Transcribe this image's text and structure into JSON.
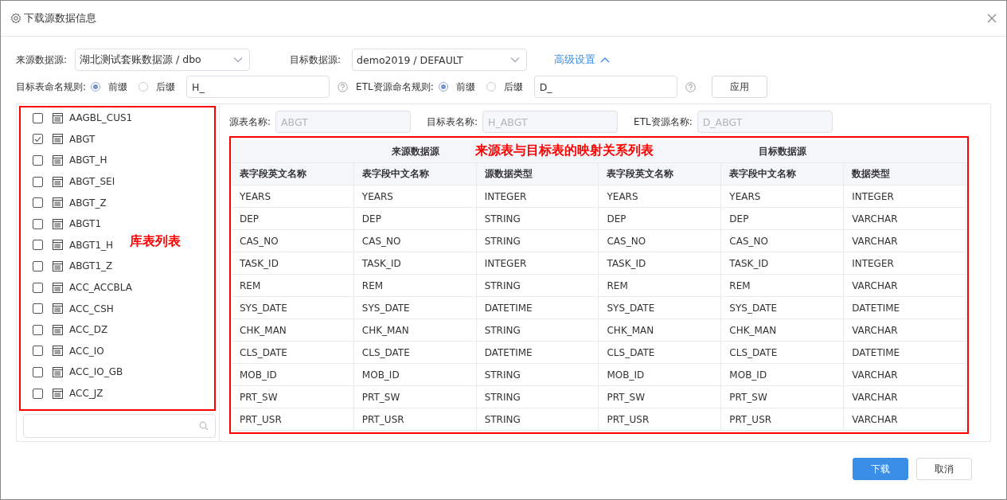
{
  "dialog": {
    "title": "下载源数据信息"
  },
  "source": {
    "label": "来源数据源:",
    "value": "湖北测试套账数据源 / dbo"
  },
  "target": {
    "label": "目标数据源:",
    "value": "demo2019 / DEFAULT"
  },
  "advanced": {
    "label": "高级设置",
    "expanded": true
  },
  "naming_rules": [
    {
      "label": "目标表命名规则:",
      "options": [
        {
          "label": "前缀",
          "selected": true
        },
        {
          "label": "后缀",
          "selected": false
        }
      ],
      "value": "H_"
    },
    {
      "label": "ETL资源命名规则:",
      "options": [
        {
          "label": "前缀",
          "selected": true
        },
        {
          "label": "后缀",
          "selected": false
        }
      ],
      "value": "D_"
    }
  ],
  "apply_button": "应用",
  "table_list": {
    "items": [
      {
        "name": "AAGBL_CUS1",
        "checked": false
      },
      {
        "name": "ABGT",
        "checked": true
      },
      {
        "name": "ABGT_H",
        "checked": false
      },
      {
        "name": "ABGT_SEI",
        "checked": false
      },
      {
        "name": "ABGT_Z",
        "checked": false
      },
      {
        "name": "ABGT1",
        "checked": false
      },
      {
        "name": "ABGT1_H",
        "checked": false
      },
      {
        "name": "ABGT1_Z",
        "checked": false
      },
      {
        "name": "ACC_ACCBLA",
        "checked": false
      },
      {
        "name": "ACC_CSH",
        "checked": false
      },
      {
        "name": "ACC_DZ",
        "checked": false
      },
      {
        "name": "ACC_IO",
        "checked": false
      },
      {
        "name": "ACC_IO_GB",
        "checked": false
      },
      {
        "name": "ACC_JZ",
        "checked": false
      }
    ],
    "annotation": "库表列表"
  },
  "names": [
    {
      "label": "源表名称:",
      "value": "ABGT"
    },
    {
      "label": "目标表名称:",
      "value": "H_ABGT"
    },
    {
      "label": "ETL资源名称:",
      "value": "D_ABGT"
    }
  ],
  "mapping": {
    "annotation": "来源表与目标表的映射关系列表",
    "groups": [
      "来源数据源",
      "目标数据源"
    ],
    "columns": [
      "表字段英文名称",
      "表字段中文名称",
      "源数据类型",
      "表字段英文名称",
      "表字段中文名称",
      "数据类型"
    ],
    "rows": [
      [
        "YEARS",
        "YEARS",
        "INTEGER",
        "YEARS",
        "YEARS",
        "INTEGER"
      ],
      [
        "DEP",
        "DEP",
        "STRING",
        "DEP",
        "DEP",
        "VARCHAR"
      ],
      [
        "CAS_NO",
        "CAS_NO",
        "STRING",
        "CAS_NO",
        "CAS_NO",
        "VARCHAR"
      ],
      [
        "TASK_ID",
        "TASK_ID",
        "INTEGER",
        "TASK_ID",
        "TASK_ID",
        "INTEGER"
      ],
      [
        "REM",
        "REM",
        "STRING",
        "REM",
        "REM",
        "VARCHAR"
      ],
      [
        "SYS_DATE",
        "SYS_DATE",
        "DATETIME",
        "SYS_DATE",
        "SYS_DATE",
        "DATETIME"
      ],
      [
        "CHK_MAN",
        "CHK_MAN",
        "STRING",
        "CHK_MAN",
        "CHK_MAN",
        "VARCHAR"
      ],
      [
        "CLS_DATE",
        "CLS_DATE",
        "DATETIME",
        "CLS_DATE",
        "CLS_DATE",
        "DATETIME"
      ],
      [
        "MOB_ID",
        "MOB_ID",
        "STRING",
        "MOB_ID",
        "MOB_ID",
        "VARCHAR"
      ],
      [
        "PRT_SW",
        "PRT_SW",
        "STRING",
        "PRT_SW",
        "PRT_SW",
        "VARCHAR"
      ],
      [
        "PRT_USR",
        "PRT_USR",
        "STRING",
        "PRT_USR",
        "PRT_USR",
        "VARCHAR"
      ]
    ]
  },
  "footer": {
    "buttons": [
      {
        "label": "下载",
        "kind": "primary"
      },
      {
        "label": "取消",
        "kind": "default"
      }
    ]
  }
}
